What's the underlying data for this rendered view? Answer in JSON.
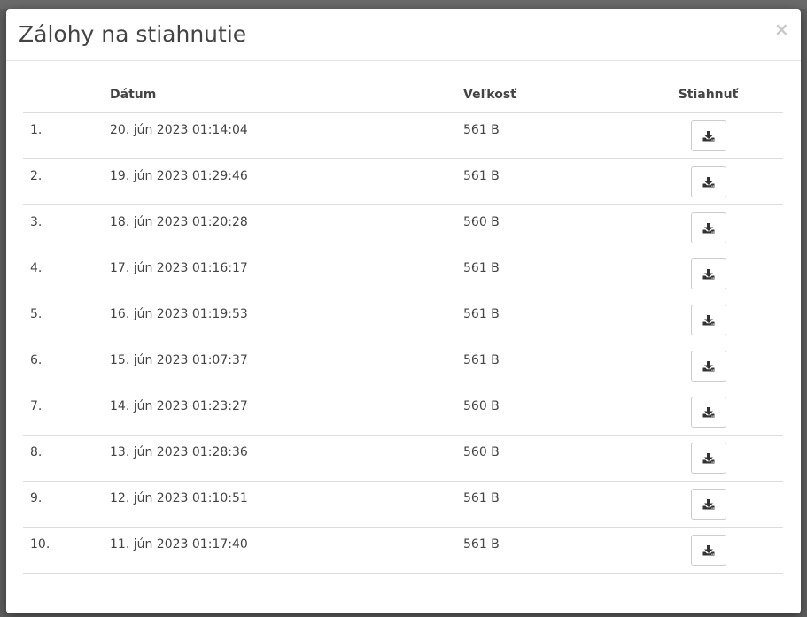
{
  "modal": {
    "title": "Zálohy na stiahnutie",
    "close_label": "×"
  },
  "table": {
    "headers": {
      "index": "",
      "date": "Dátum",
      "size": "Veľkosť",
      "download": "Stiahnuť"
    },
    "rows": [
      {
        "index": "1.",
        "date": "20. jún 2023 01:14:04",
        "size": "561 B"
      },
      {
        "index": "2.",
        "date": "19. jún 2023 01:29:46",
        "size": "561 B"
      },
      {
        "index": "3.",
        "date": "18. jún 2023 01:20:28",
        "size": "560 B"
      },
      {
        "index": "4.",
        "date": "17. jún 2023 01:16:17",
        "size": "561 B"
      },
      {
        "index": "5.",
        "date": "16. jún 2023 01:19:53",
        "size": "561 B"
      },
      {
        "index": "6.",
        "date": "15. jún 2023 01:07:37",
        "size": "561 B"
      },
      {
        "index": "7.",
        "date": "14. jún 2023 01:23:27",
        "size": "560 B"
      },
      {
        "index": "8.",
        "date": "13. jún 2023 01:28:36",
        "size": "560 B"
      },
      {
        "index": "9.",
        "date": "12. jún 2023 01:10:51",
        "size": "561 B"
      },
      {
        "index": "10.",
        "date": "11. jún 2023 01:17:40",
        "size": "561 B"
      }
    ],
    "download_icon": "download-icon"
  }
}
